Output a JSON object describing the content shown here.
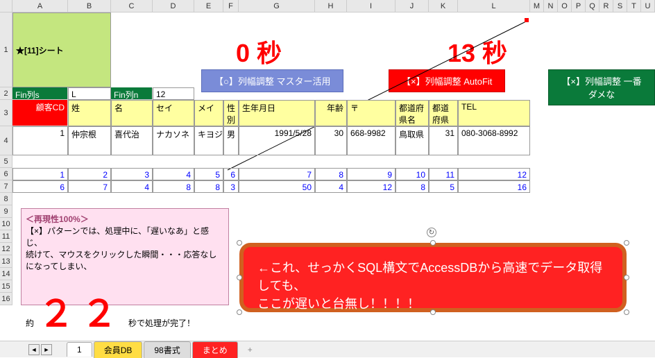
{
  "sheet_title": "★[11]シート",
  "timer_0": "0 秒",
  "timer_13": "13 秒",
  "btn_blue": "【○】列幅調整 マスター活用",
  "btn_red": "【×】列幅調整 AutoFit",
  "btn_green": "【×】列幅調整 一番ダメな",
  "row2": {
    "a": "Fin列s",
    "b": "L",
    "c": "Fin列n",
    "d": "12"
  },
  "headers": {
    "a": "顧客CD",
    "b": "姓",
    "c": "名",
    "d": "セイ",
    "e": "メイ",
    "f": "性別",
    "g": "生年月日",
    "h": "年齢",
    "i": "〒",
    "j": "都道府県名",
    "k": "都道府県CD",
    "l": "TEL"
  },
  "data_row": {
    "a": "1",
    "b": "仲宗根",
    "c": "喜代治",
    "d": "ナカソネ",
    "e": "キヨジ",
    "f": "男",
    "g": "1991/5/28",
    "h": "30",
    "i": "668-9982",
    "j": "鳥取県",
    "k": "31",
    "l": "080-3068-8992"
  },
  "row5": {
    "a": "1",
    "b": "2",
    "c": "3",
    "d": "4",
    "e": "5",
    "f": "6",
    "g": "7",
    "h": "8",
    "i": "9",
    "j": "10",
    "k": "11",
    "l": "12"
  },
  "row6": {
    "a": "6",
    "b": "7",
    "c": "4",
    "d": "8",
    "e": "8",
    "f": "3",
    "g": "50",
    "h": "4",
    "i": "12",
    "j": "8",
    "k": "5",
    "l": "16"
  },
  "pink": {
    "title": "＜再現性100%＞",
    "line1": "【×】パターンでは、処理中に、「遅いなあ」と感じ、",
    "line2": "続けて、マウスをクリックした瞬間・・・応答なしになってしまい、",
    "approx": "約",
    "big22": "２２",
    "tail": "秒で処理が完了！"
  },
  "callout": {
    "line1": "←これ、せっかくSQL構文でAccessDBから高速でデータ取得しても、",
    "line2": "ここが遅いと台無し！！！！"
  },
  "tabs": {
    "num": "1",
    "t1": "会員DB",
    "t2": "98書式",
    "t3": "まとめ",
    "plus": "+"
  },
  "cols": [
    "A",
    "B",
    "C",
    "D",
    "E",
    "F",
    "G",
    "H",
    "I",
    "J",
    "K",
    "L",
    "M",
    "N",
    "O",
    "P",
    "Q",
    "R",
    "S",
    "T",
    "U"
  ]
}
